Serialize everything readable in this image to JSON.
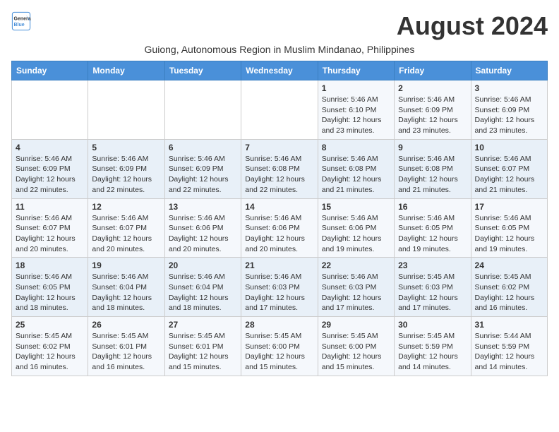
{
  "header": {
    "logo_line1": "General",
    "logo_line2": "Blue",
    "month_title": "August 2024",
    "subtitle": "Guiong, Autonomous Region in Muslim Mindanao, Philippines"
  },
  "weekdays": [
    "Sunday",
    "Monday",
    "Tuesday",
    "Wednesday",
    "Thursday",
    "Friday",
    "Saturday"
  ],
  "weeks": [
    [
      {
        "day": "",
        "info": ""
      },
      {
        "day": "",
        "info": ""
      },
      {
        "day": "",
        "info": ""
      },
      {
        "day": "",
        "info": ""
      },
      {
        "day": "1",
        "info": "Sunrise: 5:46 AM\nSunset: 6:10 PM\nDaylight: 12 hours\nand 23 minutes."
      },
      {
        "day": "2",
        "info": "Sunrise: 5:46 AM\nSunset: 6:09 PM\nDaylight: 12 hours\nand 23 minutes."
      },
      {
        "day": "3",
        "info": "Sunrise: 5:46 AM\nSunset: 6:09 PM\nDaylight: 12 hours\nand 23 minutes."
      }
    ],
    [
      {
        "day": "4",
        "info": "Sunrise: 5:46 AM\nSunset: 6:09 PM\nDaylight: 12 hours\nand 22 minutes."
      },
      {
        "day": "5",
        "info": "Sunrise: 5:46 AM\nSunset: 6:09 PM\nDaylight: 12 hours\nand 22 minutes."
      },
      {
        "day": "6",
        "info": "Sunrise: 5:46 AM\nSunset: 6:09 PM\nDaylight: 12 hours\nand 22 minutes."
      },
      {
        "day": "7",
        "info": "Sunrise: 5:46 AM\nSunset: 6:08 PM\nDaylight: 12 hours\nand 22 minutes."
      },
      {
        "day": "8",
        "info": "Sunrise: 5:46 AM\nSunset: 6:08 PM\nDaylight: 12 hours\nand 21 minutes."
      },
      {
        "day": "9",
        "info": "Sunrise: 5:46 AM\nSunset: 6:08 PM\nDaylight: 12 hours\nand 21 minutes."
      },
      {
        "day": "10",
        "info": "Sunrise: 5:46 AM\nSunset: 6:07 PM\nDaylight: 12 hours\nand 21 minutes."
      }
    ],
    [
      {
        "day": "11",
        "info": "Sunrise: 5:46 AM\nSunset: 6:07 PM\nDaylight: 12 hours\nand 20 minutes."
      },
      {
        "day": "12",
        "info": "Sunrise: 5:46 AM\nSunset: 6:07 PM\nDaylight: 12 hours\nand 20 minutes."
      },
      {
        "day": "13",
        "info": "Sunrise: 5:46 AM\nSunset: 6:06 PM\nDaylight: 12 hours\nand 20 minutes."
      },
      {
        "day": "14",
        "info": "Sunrise: 5:46 AM\nSunset: 6:06 PM\nDaylight: 12 hours\nand 20 minutes."
      },
      {
        "day": "15",
        "info": "Sunrise: 5:46 AM\nSunset: 6:06 PM\nDaylight: 12 hours\nand 19 minutes."
      },
      {
        "day": "16",
        "info": "Sunrise: 5:46 AM\nSunset: 6:05 PM\nDaylight: 12 hours\nand 19 minutes."
      },
      {
        "day": "17",
        "info": "Sunrise: 5:46 AM\nSunset: 6:05 PM\nDaylight: 12 hours\nand 19 minutes."
      }
    ],
    [
      {
        "day": "18",
        "info": "Sunrise: 5:46 AM\nSunset: 6:05 PM\nDaylight: 12 hours\nand 18 minutes."
      },
      {
        "day": "19",
        "info": "Sunrise: 5:46 AM\nSunset: 6:04 PM\nDaylight: 12 hours\nand 18 minutes."
      },
      {
        "day": "20",
        "info": "Sunrise: 5:46 AM\nSunset: 6:04 PM\nDaylight: 12 hours\nand 18 minutes."
      },
      {
        "day": "21",
        "info": "Sunrise: 5:46 AM\nSunset: 6:03 PM\nDaylight: 12 hours\nand 17 minutes."
      },
      {
        "day": "22",
        "info": "Sunrise: 5:46 AM\nSunset: 6:03 PM\nDaylight: 12 hours\nand 17 minutes."
      },
      {
        "day": "23",
        "info": "Sunrise: 5:45 AM\nSunset: 6:03 PM\nDaylight: 12 hours\nand 17 minutes."
      },
      {
        "day": "24",
        "info": "Sunrise: 5:45 AM\nSunset: 6:02 PM\nDaylight: 12 hours\nand 16 minutes."
      }
    ],
    [
      {
        "day": "25",
        "info": "Sunrise: 5:45 AM\nSunset: 6:02 PM\nDaylight: 12 hours\nand 16 minutes."
      },
      {
        "day": "26",
        "info": "Sunrise: 5:45 AM\nSunset: 6:01 PM\nDaylight: 12 hours\nand 16 minutes."
      },
      {
        "day": "27",
        "info": "Sunrise: 5:45 AM\nSunset: 6:01 PM\nDaylight: 12 hours\nand 15 minutes."
      },
      {
        "day": "28",
        "info": "Sunrise: 5:45 AM\nSunset: 6:00 PM\nDaylight: 12 hours\nand 15 minutes."
      },
      {
        "day": "29",
        "info": "Sunrise: 5:45 AM\nSunset: 6:00 PM\nDaylight: 12 hours\nand 15 minutes."
      },
      {
        "day": "30",
        "info": "Sunrise: 5:45 AM\nSunset: 5:59 PM\nDaylight: 12 hours\nand 14 minutes."
      },
      {
        "day": "31",
        "info": "Sunrise: 5:44 AM\nSunset: 5:59 PM\nDaylight: 12 hours\nand 14 minutes."
      }
    ]
  ]
}
